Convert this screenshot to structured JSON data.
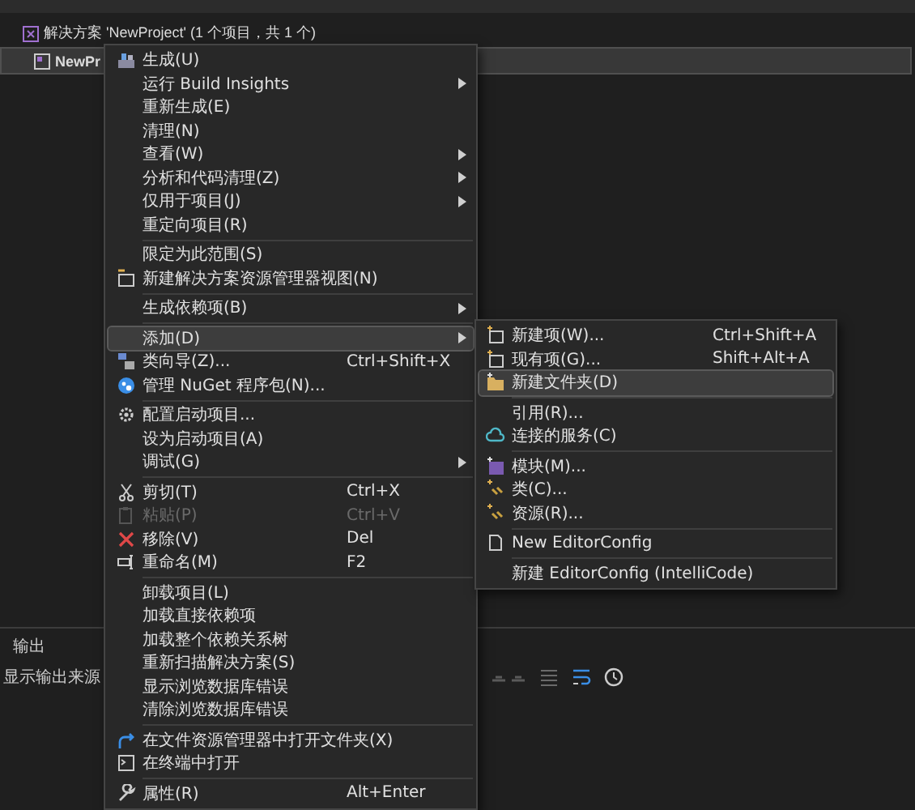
{
  "solution_explorer": {
    "items": [
      {
        "label": "解决方案 'NewProject' (1 个项目，共 1 个)",
        "selected": false
      },
      {
        "label": "NewPr",
        "selected": true
      }
    ]
  },
  "output_panel": {
    "title": "输出",
    "source_label": "显示输出来源"
  },
  "context_menu": {
    "items": [
      {
        "kind": "item",
        "label": "生成(U)",
        "submenu": false,
        "selected": false,
        "disabled": false
      },
      {
        "kind": "item",
        "label": "运行 Build Insights",
        "submenu": true,
        "selected": false,
        "disabled": false
      },
      {
        "kind": "item",
        "label": "重新生成(E)",
        "submenu": false,
        "selected": false,
        "disabled": false
      },
      {
        "kind": "item",
        "label": "清理(N)",
        "submenu": false,
        "selected": false,
        "disabled": false
      },
      {
        "kind": "item",
        "label": "查看(W)",
        "submenu": true,
        "selected": false,
        "disabled": false
      },
      {
        "kind": "item",
        "label": "分析和代码清理(Z)",
        "submenu": true,
        "selected": false,
        "disabled": false
      },
      {
        "kind": "item",
        "label": "仅用于项目(J)",
        "submenu": true,
        "selected": false,
        "disabled": false
      },
      {
        "kind": "item",
        "label": "重定向项目(R)",
        "submenu": false,
        "selected": false,
        "disabled": false
      },
      {
        "kind": "separator"
      },
      {
        "kind": "item",
        "label": "限定为此范围(S)",
        "submenu": false,
        "selected": false,
        "disabled": false
      },
      {
        "kind": "item",
        "label": "新建解决方案资源管理器视图(N)",
        "submenu": false,
        "selected": false,
        "disabled": false
      },
      {
        "kind": "separator"
      },
      {
        "kind": "item",
        "label": "生成依赖项(B)",
        "submenu": true,
        "selected": false,
        "disabled": false
      },
      {
        "kind": "separator"
      },
      {
        "kind": "item",
        "label": "添加(D)",
        "submenu": true,
        "selected": true,
        "disabled": false
      },
      {
        "kind": "item",
        "label": "类向导(Z)...",
        "shortcut": "Ctrl+Shift+X",
        "submenu": false,
        "selected": false,
        "disabled": false
      },
      {
        "kind": "item",
        "label": "管理 NuGet 程序包(N)...",
        "submenu": false,
        "selected": false,
        "disabled": false
      },
      {
        "kind": "separator"
      },
      {
        "kind": "item",
        "label": "配置启动项目...",
        "submenu": false,
        "selected": false,
        "disabled": false
      },
      {
        "kind": "item",
        "label": "设为启动项目(A)",
        "submenu": false,
        "selected": false,
        "disabled": false
      },
      {
        "kind": "item",
        "label": "调试(G)",
        "submenu": true,
        "selected": false,
        "disabled": false
      },
      {
        "kind": "separator"
      },
      {
        "kind": "item",
        "label": "剪切(T)",
        "shortcut": "Ctrl+X",
        "submenu": false,
        "selected": false,
        "disabled": false
      },
      {
        "kind": "item",
        "label": "粘贴(P)",
        "shortcut": "Ctrl+V",
        "submenu": false,
        "selected": false,
        "disabled": true
      },
      {
        "kind": "item",
        "label": "移除(V)",
        "shortcut": "Del",
        "submenu": false,
        "selected": false,
        "disabled": false
      },
      {
        "kind": "item",
        "label": "重命名(M)",
        "shortcut": "F2",
        "submenu": false,
        "selected": false,
        "disabled": false
      },
      {
        "kind": "separator"
      },
      {
        "kind": "item",
        "label": "卸载项目(L)",
        "submenu": false,
        "selected": false,
        "disabled": false
      },
      {
        "kind": "item",
        "label": "加载直接依赖项",
        "submenu": false,
        "selected": false,
        "disabled": false
      },
      {
        "kind": "item",
        "label": "加载整个依赖关系树",
        "submenu": false,
        "selected": false,
        "disabled": false
      },
      {
        "kind": "item",
        "label": "重新扫描解决方案(S)",
        "submenu": false,
        "selected": false,
        "disabled": false
      },
      {
        "kind": "item",
        "label": "显示浏览数据库错误",
        "submenu": false,
        "selected": false,
        "disabled": false
      },
      {
        "kind": "item",
        "label": "清除浏览数据库错误",
        "submenu": false,
        "selected": false,
        "disabled": false
      },
      {
        "kind": "separator"
      },
      {
        "kind": "item",
        "label": "在文件资源管理器中打开文件夹(X)",
        "submenu": false,
        "selected": false,
        "disabled": false
      },
      {
        "kind": "item",
        "label": "在终端中打开",
        "submenu": false,
        "selected": false,
        "disabled": false
      },
      {
        "kind": "separator"
      },
      {
        "kind": "item",
        "label": "属性(R)",
        "shortcut": "Alt+Enter",
        "submenu": false,
        "selected": false,
        "disabled": false
      }
    ]
  },
  "add_submenu": {
    "items": [
      {
        "kind": "item",
        "label": "新建项(W)...",
        "shortcut": "Ctrl+Shift+A",
        "selected": false
      },
      {
        "kind": "item",
        "label": "现有项(G)...",
        "shortcut": "Shift+Alt+A",
        "selected": false
      },
      {
        "kind": "item",
        "label": "新建文件夹(D)",
        "selected": true
      },
      {
        "kind": "separator"
      },
      {
        "kind": "item",
        "label": "引用(R)...",
        "selected": false
      },
      {
        "kind": "item",
        "label": "连接的服务(C)",
        "selected": false
      },
      {
        "kind": "separator"
      },
      {
        "kind": "item",
        "label": "模块(M)...",
        "selected": false
      },
      {
        "kind": "item",
        "label": "类(C)...",
        "selected": false
      },
      {
        "kind": "item",
        "label": "资源(R)...",
        "selected": false
      },
      {
        "kind": "separator"
      },
      {
        "kind": "item",
        "label": "New EditorConfig",
        "selected": false
      },
      {
        "kind": "separator"
      },
      {
        "kind": "item",
        "label": "新建 EditorConfig (IntelliCode)",
        "selected": false
      }
    ]
  }
}
